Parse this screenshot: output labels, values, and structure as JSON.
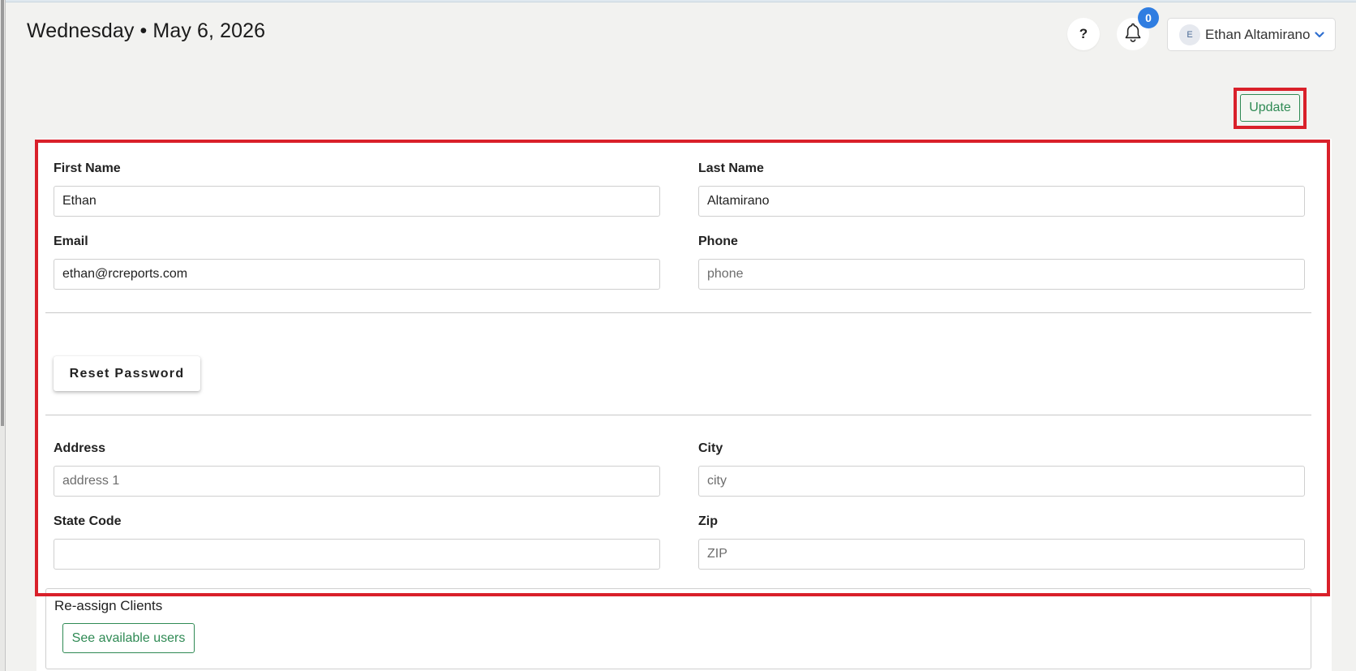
{
  "header": {
    "date_title": "Wednesday • May 6, 2026",
    "help_label": "?",
    "notification_count": "0",
    "user": {
      "avatar_initial": "E",
      "name": "Ethan Altamirano"
    }
  },
  "toolbar": {
    "update_label": "Update"
  },
  "form": {
    "first_name": {
      "label": "First Name",
      "value": "Ethan",
      "placeholder": ""
    },
    "last_name": {
      "label": "Last Name",
      "value": "Altamirano",
      "placeholder": ""
    },
    "email": {
      "label": "Email",
      "value": "ethan@rcreports.com",
      "placeholder": ""
    },
    "phone": {
      "label": "Phone",
      "value": "",
      "placeholder": "phone"
    },
    "reset_password_label": "Reset Password",
    "address": {
      "label": "Address",
      "value": "",
      "placeholder": "address 1"
    },
    "city": {
      "label": "City",
      "value": "",
      "placeholder": "city"
    },
    "state_code": {
      "label": "State Code",
      "value": "",
      "placeholder": ""
    },
    "zip": {
      "label": "Zip",
      "value": "",
      "placeholder": "ZIP"
    }
  },
  "reassign": {
    "title": "Re-assign Clients",
    "button_label": "See available users"
  },
  "colors": {
    "highlight": "#d9202a",
    "accent_green": "#2f8a54",
    "badge_blue": "#2f7de1",
    "background": "#f2f2f0"
  },
  "icons": {
    "bell": "bell-icon",
    "chevron": "chevron-down-icon"
  }
}
